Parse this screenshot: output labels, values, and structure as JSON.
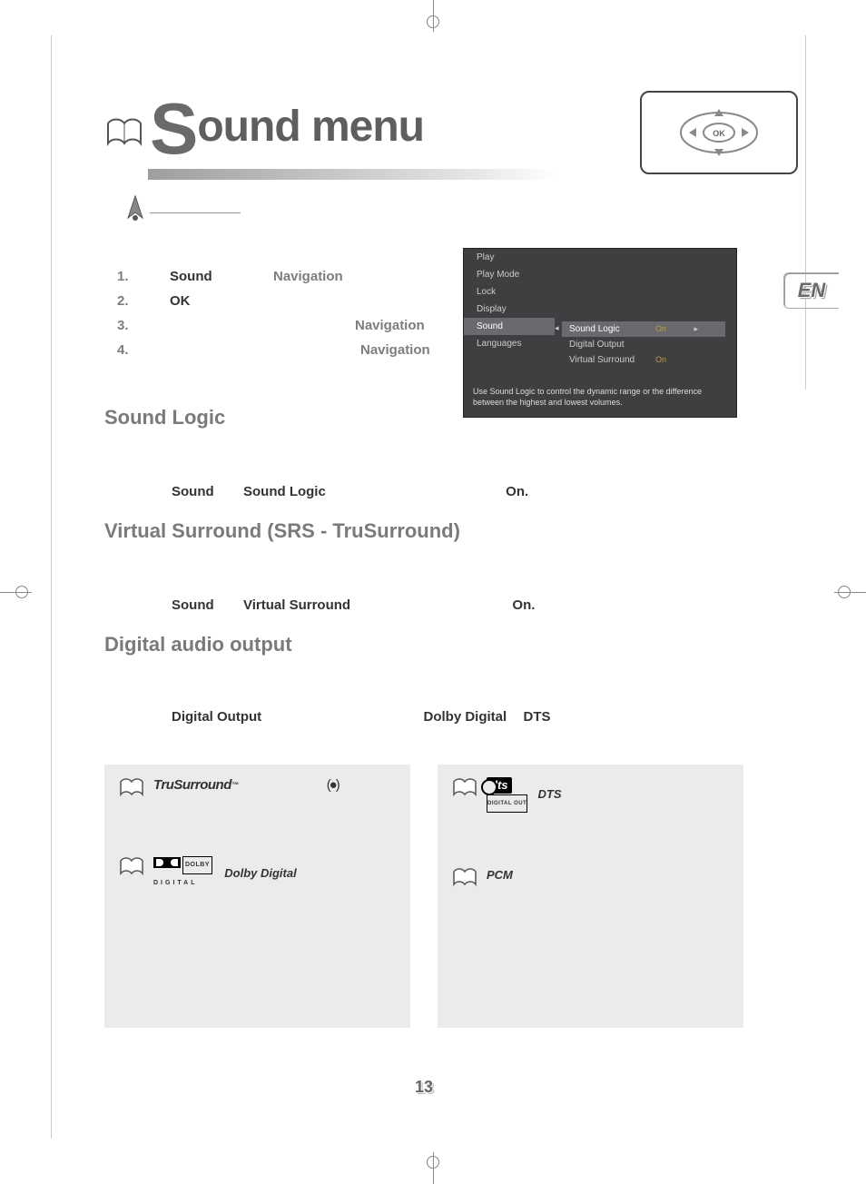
{
  "page_number": "13",
  "lang_tag": "EN",
  "title_initial": "S",
  "title_rest": "ound menu",
  "nav_widget_label": "OK",
  "steps": [
    {
      "n": "1.",
      "col1": "Sound",
      "col2": "Navigation"
    },
    {
      "n": "2.",
      "col1": "OK",
      "col2": ""
    },
    {
      "n": "3.",
      "col1": "",
      "col2": "Navigation"
    },
    {
      "n": "4.",
      "col1": "",
      "col2": "Navigation"
    }
  ],
  "osd": {
    "left_items": [
      "Play",
      "Play Mode",
      "Lock",
      "Display",
      "Sound",
      "Languages"
    ],
    "left_selected_index": 4,
    "right_rows": [
      {
        "label": "Sound Logic",
        "value": "On",
        "selected": true
      },
      {
        "label": "Digital Output",
        "value": "",
        "selected": false
      },
      {
        "label": "Virtual Surround",
        "value": "On",
        "selected": false
      }
    ],
    "description": "Use Sound Logic to control the dynamic range or the difference between the highest and lowest volumes."
  },
  "sections": {
    "sound_logic": {
      "heading": "Sound Logic",
      "line_a": "Sound",
      "line_b": "Sound Logic",
      "line_c": "On."
    },
    "virtual_surround": {
      "heading": "Virtual Surround (SRS    - TruSurround)",
      "line_a": "Sound",
      "line_b": "Virtual Surround",
      "line_c": "On."
    },
    "digital_output": {
      "heading": "Digital audio output",
      "line_a": "Digital Output",
      "line_b": "Dolby Digital",
      "line_c": "DTS"
    }
  },
  "info_left": {
    "trusurround_logo": "TruSurround",
    "tm": "™",
    "symbol": "(●)",
    "dolby_prefix": "DOLBY",
    "dolby_under": "DIGITAL",
    "dolby_label": "Dolby   Digital"
  },
  "info_right": {
    "dts_label": "DTS",
    "dts_out": "DIGITAL OUT",
    "pcm_label": "PCM"
  }
}
